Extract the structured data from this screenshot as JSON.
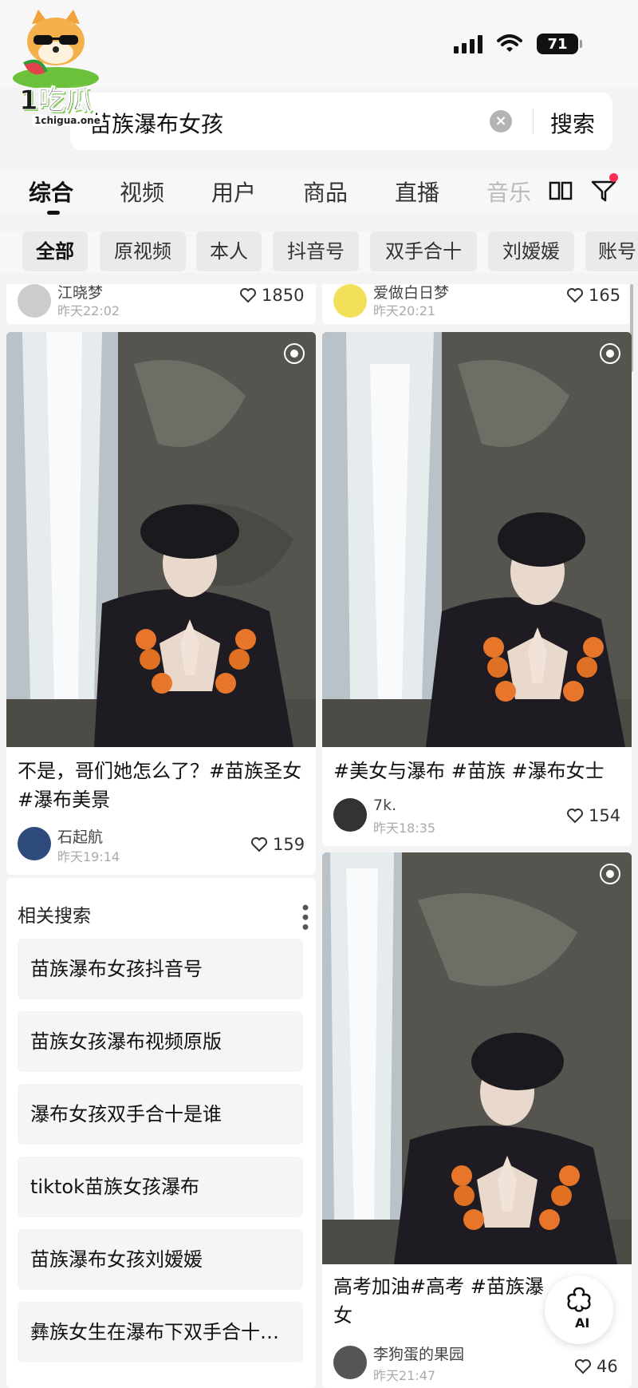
{
  "status_bar": {
    "battery": "71"
  },
  "watermark": {
    "brand": "1吃瓜",
    "site": "1chigua.one"
  },
  "search": {
    "query": "苗族瀑布女孩",
    "button_label": "搜索"
  },
  "tabs": [
    {
      "label": "综合",
      "active": true
    },
    {
      "label": "视频"
    },
    {
      "label": "用户"
    },
    {
      "label": "商品"
    },
    {
      "label": "直播"
    },
    {
      "label": "音乐"
    }
  ],
  "chips": [
    "全部",
    "原视频",
    "本人",
    "抖音号",
    "双手合十",
    "刘嫒媛",
    "账号"
  ],
  "cards": [
    {
      "author": "江晓梦",
      "time": "昨天22:02",
      "likes": "1850"
    },
    {
      "author": "爱做白日梦",
      "time": "昨天20:21",
      "likes": "165"
    },
    {
      "title": "不是，哥们她怎么了？#苗族圣女 #瀑布美景",
      "author": "石起航",
      "time": "昨天19:14",
      "likes": "159"
    },
    {
      "title": "#美女与瀑布 #苗族 #瀑布女士",
      "author": "7k.",
      "time": "昨天18:35",
      "likes": "154"
    },
    {
      "title": "高考加油#高考 #苗族瀑布女",
      "title_line1": "高考加油#高考 #苗族瀑",
      "title_line2": "女",
      "author": "李狗蛋的果园",
      "time": "昨天21:47",
      "likes": "46"
    }
  ],
  "related": {
    "title": "相关搜索",
    "items": [
      "苗族瀑布女孩抖音号",
      "苗族女孩瀑布视频原版",
      "瀑布女孩双手合十是谁",
      "tiktok苗族女孩瀑布",
      "苗族瀑布女孩刘嫒媛",
      "彝族女生在瀑布下双手合十…"
    ]
  },
  "ai_button": {
    "label": "AI"
  },
  "colors": {
    "accent": "#fe2c55",
    "background": "#f3f3f3",
    "card": "#ffffff"
  },
  "icons": [
    "signal-icon",
    "wifi-icon",
    "battery-icon",
    "clear-icon",
    "book-icon",
    "filter-icon",
    "heart-icon",
    "live-photo-icon",
    "more-icon",
    "ai-icon"
  ]
}
